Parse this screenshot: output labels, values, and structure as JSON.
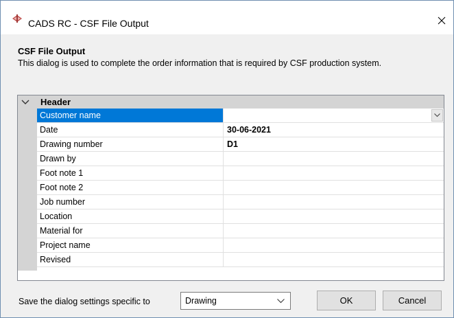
{
  "window": {
    "title": "CADS RC - CSF File Output",
    "close_icon": "close-icon"
  },
  "header": {
    "title": "CSF File Output",
    "description": "This dialog is used to complete the order information that is required by CSF production system."
  },
  "property_grid": {
    "category": "Header",
    "rows": [
      {
        "name": "Customer name",
        "value": "",
        "selected": true,
        "has_dropdown": true
      },
      {
        "name": "Date",
        "value": "30-06-2021"
      },
      {
        "name": "Drawing number",
        "value": "D1"
      },
      {
        "name": "Drawn by",
        "value": ""
      },
      {
        "name": "Foot note 1",
        "value": ""
      },
      {
        "name": "Foot note 2",
        "value": ""
      },
      {
        "name": "Job number",
        "value": ""
      },
      {
        "name": "Location",
        "value": ""
      },
      {
        "name": "Material for",
        "value": ""
      },
      {
        "name": "Project name",
        "value": ""
      },
      {
        "name": "Revised",
        "value": ""
      }
    ]
  },
  "footer": {
    "save_label": "Save the dialog settings specific to",
    "save_scope_value": "Drawing",
    "ok_label": "OK",
    "cancel_label": "Cancel"
  },
  "colors": {
    "selection": "#0078d7",
    "category_bg": "#d4d4d4",
    "dialog_bg": "#f0f0f0"
  }
}
